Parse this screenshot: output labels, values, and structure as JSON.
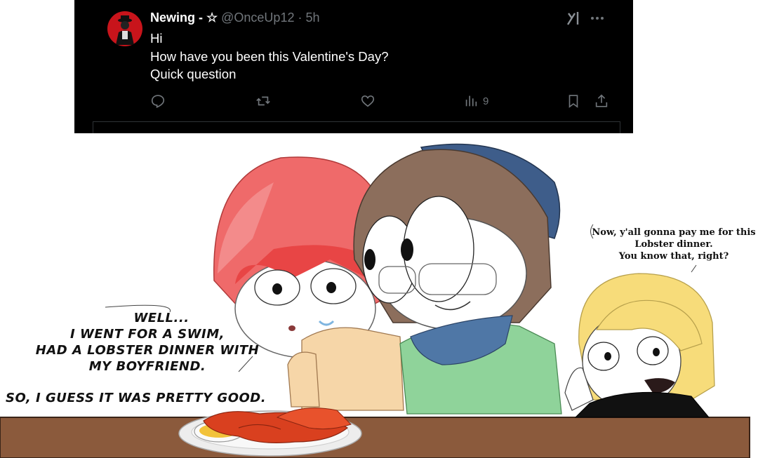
{
  "tweet": {
    "display_name": "Newing - ☆",
    "handle": "@OnceUp12",
    "separator": "·",
    "time": "5h",
    "text_lines": [
      "Hi",
      "How have you been this Valentine's Day?",
      "Quick question"
    ],
    "views_count": "9",
    "icons": {
      "avatar": "profile-avatar",
      "grok": "grok-icon",
      "more": "more-icon",
      "reply": "reply-icon",
      "repost": "repost-icon",
      "like": "heart-icon",
      "views": "views-icon",
      "bookmark": "bookmark-icon",
      "share": "share-icon"
    },
    "colors": {
      "background": "#000000",
      "text": "#ffffff",
      "muted": "#71767b",
      "avatar": "#c8141b"
    }
  },
  "comic": {
    "left_bubble_lines": [
      "WELL...",
      "I WENT FOR A SWIM,",
      "HAD A LOBSTER DINNER WITH",
      "MY BOYFRIEND.",
      "SO, I GUESS IT WAS PRETTY GOOD."
    ],
    "right_bubble_lines": [
      "Now, y'all gonna pay me for this",
      "Lobster dinner.",
      "You know that, right?"
    ],
    "colors": {
      "table": "#8b5a3c",
      "lobster": "#d9401f",
      "pink_hair": "#f07a7a",
      "beanie": "#3e5d8a",
      "blonde_hair": "#f7dc7a"
    }
  }
}
